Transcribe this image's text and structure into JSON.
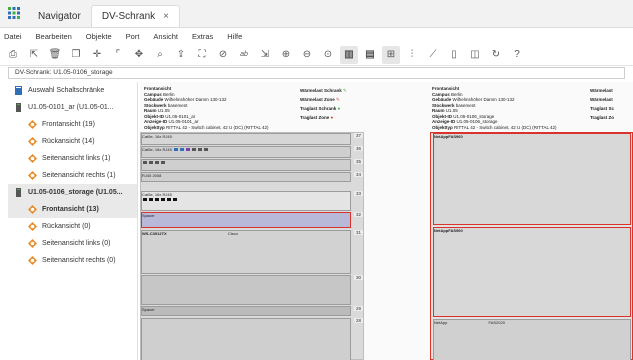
{
  "window": {
    "tabs": [
      {
        "label": "Navigator"
      },
      {
        "label": "DV-Schrank",
        "close": "×"
      }
    ]
  },
  "menu": [
    "Datei",
    "Bearbeiten",
    "Objekte",
    "Port",
    "Ansicht",
    "Extras",
    "Hilfe"
  ],
  "toolbar_icons": [
    "print-icon",
    "export-icon",
    "delete-icon",
    "copy-icon",
    "move-icon",
    "select-icon",
    "pan-icon",
    "search-device-icon",
    "upload-icon",
    "network-icon",
    "link-icon",
    "text-icon",
    "measure-icon",
    "zoom-in-icon",
    "zoom-out-icon",
    "zoom-fit-icon",
    "front-view-icon",
    "rear-view-icon",
    "grid-icon",
    "align-icon",
    "connect-icon",
    "clipboard-icon",
    "layers-icon",
    "refresh-icon",
    "help-icon"
  ],
  "breadcrumb": "DV-Schrank: U1.05-0106_storage",
  "sidebar": {
    "items": [
      {
        "label": "Auswahl Schaltschränke",
        "level": 0
      },
      {
        "label": "U1.05-0101_ar (U1.05-01...",
        "level": 0
      },
      {
        "label": "Frontansicht (19)",
        "level": 1
      },
      {
        "label": "Rückansicht (14)",
        "level": 1
      },
      {
        "label": "Seitenansicht links (1)",
        "level": 1
      },
      {
        "label": "Seitenansicht rechts (1)",
        "level": 1
      },
      {
        "label": "U1.05-0106_storage (U1.05...",
        "level": 0,
        "selected": true
      },
      {
        "label": "Frontansicht (13)",
        "level": 1,
        "selected": true
      },
      {
        "label": "Rückansicht (0)",
        "level": 1
      },
      {
        "label": "Seitenansicht links (0)",
        "level": 1
      },
      {
        "label": "Seitenansicht rechts (0)",
        "level": 1
      }
    ]
  },
  "left_rack": {
    "header": "Frontansicht",
    "info": [
      [
        "Campus",
        "Berlin"
      ],
      [
        "Gebäude",
        "Wilhelmshöher Damm 130-132"
      ],
      [
        "Stockwerk",
        "basement"
      ],
      [
        "Raum",
        "U1.05"
      ],
      [
        "Objekt-ID",
        "U1.05-0101_ar"
      ],
      [
        "Anzeige-ID",
        "U1.05-0101_ar"
      ],
      [
        "Objekttyp",
        "RITTAL 42 - Switch cabinet, 42 U (DC) (RITTAL 42)"
      ]
    ],
    "legend": [
      "Wärmelast Schrank",
      "Wärmelast Zone",
      "Traglast Schrank",
      "Traglast Zone"
    ],
    "units": [
      "37",
      "36",
      "35",
      "34",
      "33",
      "32",
      "31",
      "30",
      "29",
      "28",
      "27",
      "26"
    ],
    "devices": [
      "Cat5e, 16x RJ45",
      "Cat5e, 16x RJ45",
      "RJ45 2008",
      "Cat5e, 16x RJ45",
      "Spacer",
      "WS-C3912TX",
      "Cisco",
      "Spacer"
    ]
  },
  "right_rack": {
    "header": "Frontansicht",
    "info": [
      [
        "Campus",
        "Berlin"
      ],
      [
        "Gebäude",
        "Wilhelmshöher Damm 130-132"
      ],
      [
        "Stockwerk",
        "basement"
      ],
      [
        "Raum",
        "U1.05"
      ],
      [
        "Objekt-ID",
        "U1.05-0106_storage"
      ],
      [
        "Anzeige-ID",
        "U1.05-0106_storage"
      ],
      [
        "Objekttyp",
        "RITTAL 42 - Switch cabinet, 42 U (DC) (RITTAL 42)"
      ]
    ],
    "legend": [
      "Wärmelast",
      "Wärmelast",
      "Traglast Sc",
      "Traglast Zo"
    ],
    "devices": [
      "NetAppFAS960",
      "NetAppFAS960",
      "NetApp",
      "FAS2020"
    ]
  },
  "colors": {
    "accent": "#2e6fb7",
    "selection": "#e9e9e9",
    "rack": "#dadada",
    "green": "#3cb043",
    "red": "#d9332b"
  }
}
